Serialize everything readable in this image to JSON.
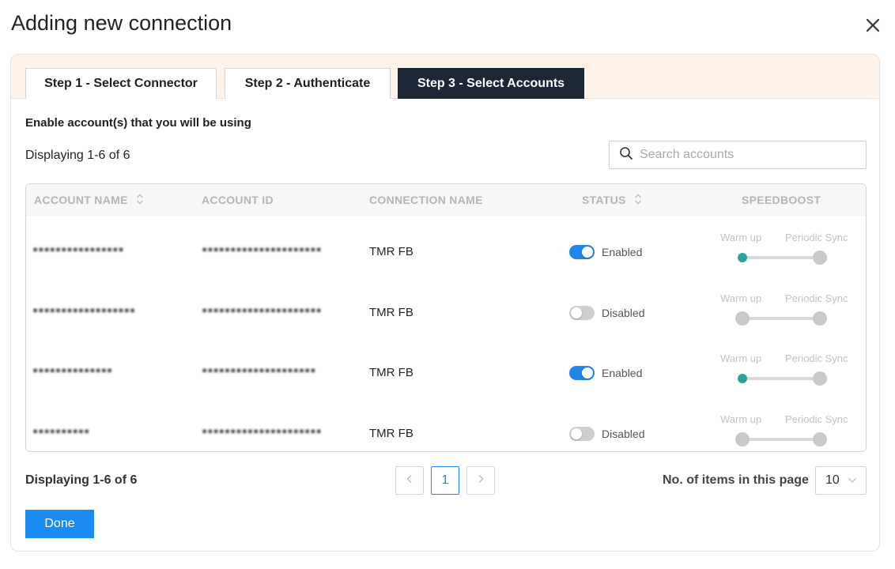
{
  "dialog": {
    "title": "Adding new connection"
  },
  "tabs": [
    {
      "label": "Step 1 - Select Connector",
      "active": false
    },
    {
      "label": "Step 2 - Authenticate",
      "active": false
    },
    {
      "label": "Step 3 - Select Accounts",
      "active": true
    }
  ],
  "instructions": "Enable account(s) that you will be using",
  "display_count": "Displaying 1-6 of 6",
  "search": {
    "placeholder": "Search accounts",
    "value": "",
    "icon": "search-icon"
  },
  "table": {
    "headers": {
      "account_name": "ACCOUNT NAME",
      "account_id": "ACCOUNT ID",
      "connection_name": "CONNECTION NAME",
      "status": "STATUS",
      "speedboost": "SPEEDBOOST"
    },
    "speedboost_labels": {
      "warm_up": "Warm up",
      "periodic_sync": "Periodic Sync"
    },
    "rows": [
      {
        "account_name": "▪▪▪▪▪▪▪▪▪▪▪▪▪▪▪▪",
        "account_id": "▪▪▪▪▪▪▪▪▪▪▪▪▪▪▪▪▪▪▪▪▪",
        "connection_name": "TMR FB",
        "status": "Enabled",
        "enabled": true
      },
      {
        "account_name": "▪▪▪▪▪▪▪▪▪▪▪▪▪▪▪▪▪▪",
        "account_id": "▪▪▪▪▪▪▪▪▪▪▪▪▪▪▪▪▪▪▪▪▪",
        "connection_name": "TMR FB",
        "status": "Disabled",
        "enabled": false
      },
      {
        "account_name": "▪▪▪▪▪▪▪▪▪▪▪▪▪▪",
        "account_id": "▪▪▪▪▪▪▪▪▪▪▪▪▪▪▪▪▪▪▪▪",
        "connection_name": "TMR FB",
        "status": "Enabled",
        "enabled": true
      },
      {
        "account_name": "▪▪▪▪▪▪▪▪▪▪",
        "account_id": "▪▪▪▪▪▪▪▪▪▪▪▪▪▪▪▪▪▪▪▪▪",
        "connection_name": "TMR FB",
        "status": "Disabled",
        "enabled": false
      }
    ]
  },
  "pagination": {
    "display_count": "Displaying 1-6 of 6",
    "prev": "<",
    "current_page": "1",
    "next": ">",
    "items_label": "No. of items in this page",
    "items_per_page": "10"
  },
  "done_label": "Done",
  "colors": {
    "active_tab": "#1d2736",
    "tab_bar_bg": "#fdf3ea",
    "toggle_on": "#1e86e8",
    "toggle_off": "#cfcfcf",
    "warm_up_dot_active": "#2aa39a",
    "slider_inactive": "#c9c9c9",
    "primary_button": "#1a8cf0"
  }
}
